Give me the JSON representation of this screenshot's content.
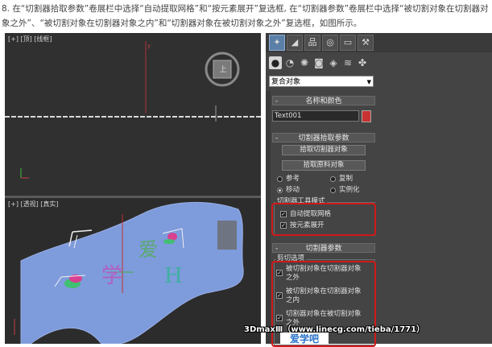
{
  "instruction": {
    "text": "8. 在“切割器拾取参数”卷展栏中选择“自动提取网格”和“按元素展开”复选框, 在“切割器参数”卷展栏中选择“被切割对象在切割器对象之外”、“被切割对象在切割器对象之内”和“切割器对象在被切割对象之外”复选框，如图所示。"
  },
  "viewports": {
    "top_label": "[+] [顶] [线框]",
    "top_nav_glyph": "上",
    "persp_label": "[+] [透视] [真实]",
    "persp_text_h": "H",
    "persp_text_ai": "爱",
    "persp_text_xue": "学"
  },
  "command_panel": {
    "tabs": [
      "create-tab",
      "modify-tab",
      "hierarchy-tab",
      "motion-tab",
      "display-tab",
      "utilities-tab"
    ],
    "subcategory_icons": [
      "geometry-icon",
      "shapes-icon",
      "lights-icon",
      "cameras-icon",
      "helpers-icon",
      "spacewarps-icon",
      "systems-icon"
    ],
    "category_dropdown": "复合对象"
  },
  "name_color": {
    "title": "名称和颜色",
    "name_value": "Text001",
    "color": "#c83232"
  },
  "pick_params": {
    "title": "切割器拾取参数",
    "pick_cutter_button": "拾取切割器对象",
    "pick_original_button": "拾取原料对象",
    "reference": "参考",
    "copy": "复制",
    "move": "移动",
    "instance": "实例化",
    "tool_mode_label": "切割器工具模式",
    "auto_extract_mesh": "自动提取网格",
    "explode_by_element": "按元素展开"
  },
  "cutter_params": {
    "title": "切割器参数",
    "cut_options_label": "剪切选项",
    "outside_cutter": "被切割对象在切割器对象之外",
    "inside_cutter": "被切割对象在切割器对象之内",
    "cutter_outside": "切割器对象在被切割对象之外"
  },
  "watermark": {
    "text": "3DmaxⅢ（www.linecg.com/tieba/1771）",
    "logo": "爱学吧"
  }
}
